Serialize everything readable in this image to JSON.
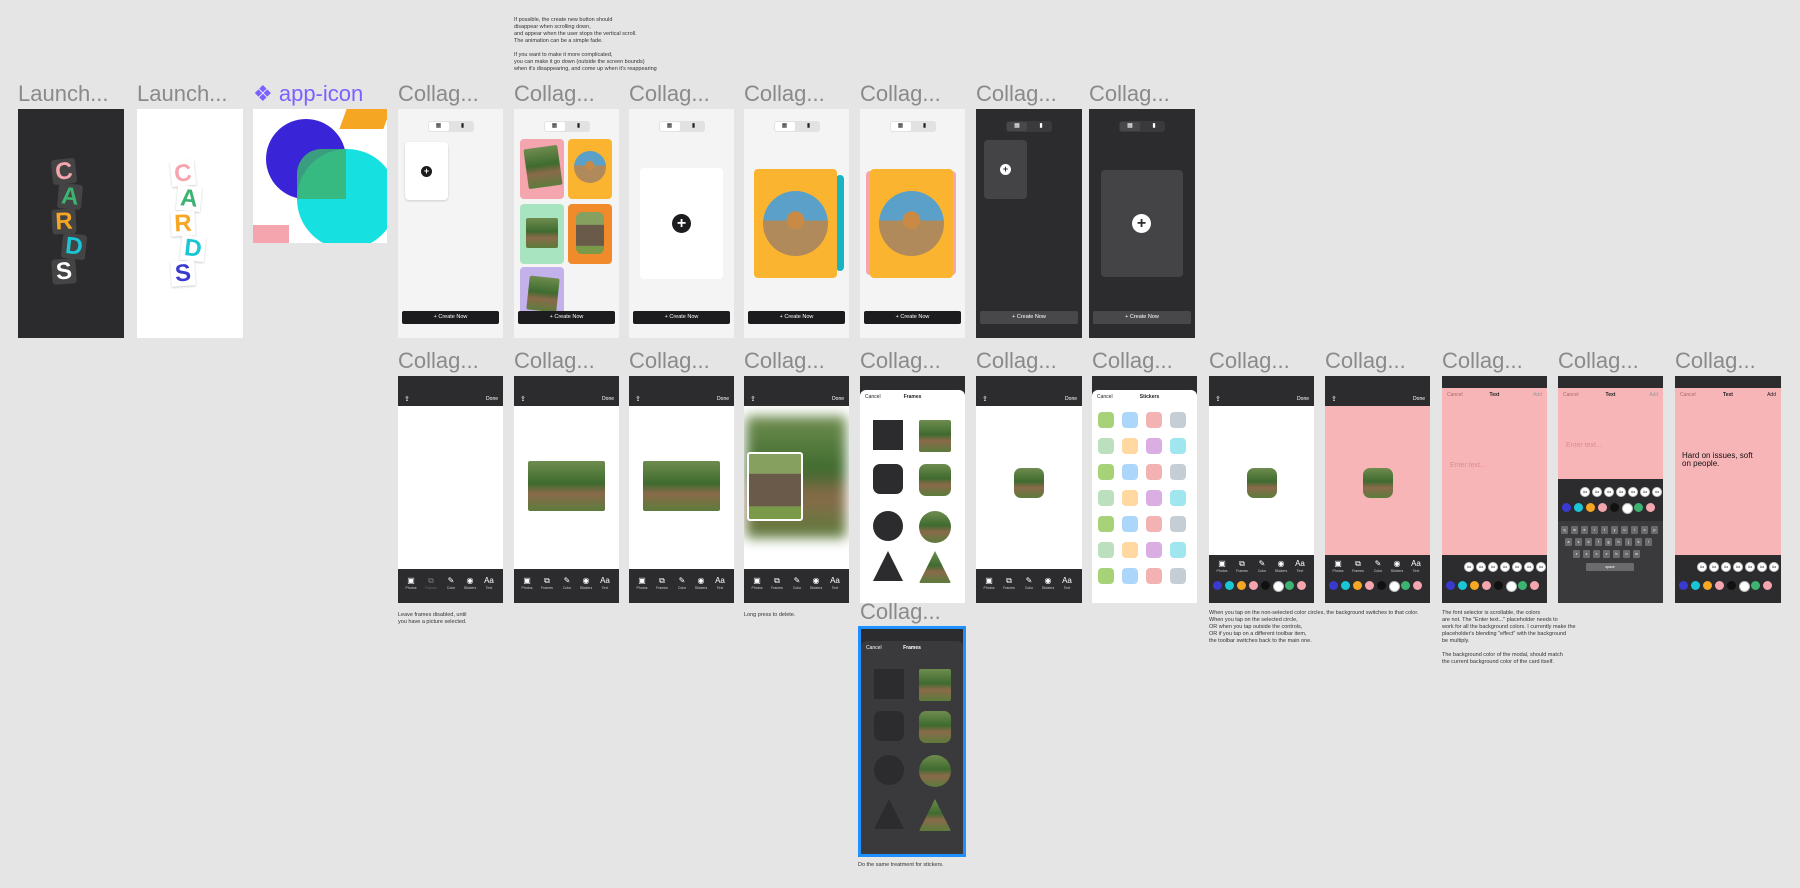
{
  "labels": {
    "launch1": "Launch...",
    "launch2": "Launch...",
    "app_icon": "app-icon",
    "collage": "Collag..."
  },
  "logo": {
    "letters": [
      "C",
      "A",
      "R",
      "D",
      "S"
    ]
  },
  "notes": {
    "scroll": "If possible, the create new button should\ndisappear when scrolling down,\nand appear when the user stops the vertical scroll.\nThe animation can be a simple fade.\n\nIf you want to make it more complicated,\nyou can make it go down (outside the screen bounds)\nwhen it's disappearing, and come up when it's reappearing",
    "frames_disabled": "Leave frames disabled, until\nyou have a picture selected.",
    "long_press": "Long press to delete.",
    "stickers": "Do the same treatment for stickers.",
    "bg_color": "When you tap on the non-selected color circles, the background switches to that color.\nWhen you tap on the selected circle,\nOR when you tap outside the controls,\nOR if you tap on a different toolbar item,\nthe toolbar switches back to the main one.",
    "font_selector": "The font selector is scrollable, the colors\nare not. The \"Enter text...\" placeholder needs to\nwork for all the background colors. I currently make the\nplaceholder's blending \"effect\" with the background\nbe multiply.\n\nThe background color of the modal, should match\nthe current background color of the card itself."
  },
  "ui": {
    "create_now": "+ Create Now",
    "done": "Done",
    "cancel": "Cancel",
    "frames": "Frames",
    "stickers": "Stickers",
    "text": "Text",
    "add": "Add",
    "enter_text": "Enter text...",
    "typed_text": "Hard on issues, soft on people.",
    "space": "space"
  },
  "toolbar": {
    "items": [
      {
        "icon": "▣",
        "label": "Photos"
      },
      {
        "icon": "⧉",
        "label": "Frames"
      },
      {
        "icon": "✎",
        "label": "Color"
      },
      {
        "icon": "◉",
        "label": "Stickers"
      },
      {
        "icon": "Aa",
        "label": "Text"
      }
    ]
  },
  "fonts": [
    "Aa",
    "Aa",
    "Aa",
    "Aa",
    "Aa",
    "Aa",
    "Aa"
  ],
  "colors": {
    "accent": "#7b61ff",
    "selection": "#1e90ff",
    "swatches": [
      "#3a3ad0",
      "#19c6d6",
      "#f5a623",
      "#f4a5ad",
      "#111111",
      "#ffffff",
      "#3cb371",
      "#f4a5ad"
    ],
    "pink_bg": "#f7b5b8",
    "yellow_card": "#fbb430"
  },
  "keyboard": {
    "row1": [
      "q",
      "w",
      "e",
      "r",
      "t",
      "y",
      "u",
      "i",
      "o",
      "p"
    ],
    "row2": [
      "a",
      "s",
      "d",
      "f",
      "g",
      "h",
      "j",
      "k",
      "l"
    ],
    "row3": [
      "z",
      "x",
      "c",
      "v",
      "b",
      "n",
      "m"
    ]
  }
}
